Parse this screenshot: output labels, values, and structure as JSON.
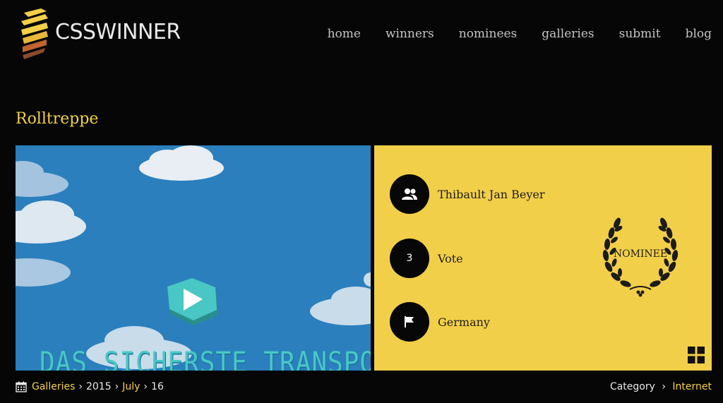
{
  "brand": {
    "name": "CSSWINNER"
  },
  "nav": {
    "items": [
      "home",
      "winners",
      "nominees",
      "galleries",
      "submit",
      "blog"
    ]
  },
  "page": {
    "title": "Rolltreppe"
  },
  "preview": {
    "headline": "DAS SICHERSTE TRANSPORTMITTEL?"
  },
  "info": {
    "designer": "Thibault Jan Beyer",
    "vote_count": "3",
    "vote_label": "Vote",
    "country": "Germany",
    "badge": "NOMINEE"
  },
  "breadcrumb": {
    "galleries": "Galleries",
    "year": "2015",
    "month": "July",
    "day": "16"
  },
  "category": {
    "label": "Category",
    "value": "Internet"
  },
  "colors": {
    "accent": "#f2cf48",
    "preview_bg": "#2b7fbd",
    "play": "#48c7c4"
  }
}
